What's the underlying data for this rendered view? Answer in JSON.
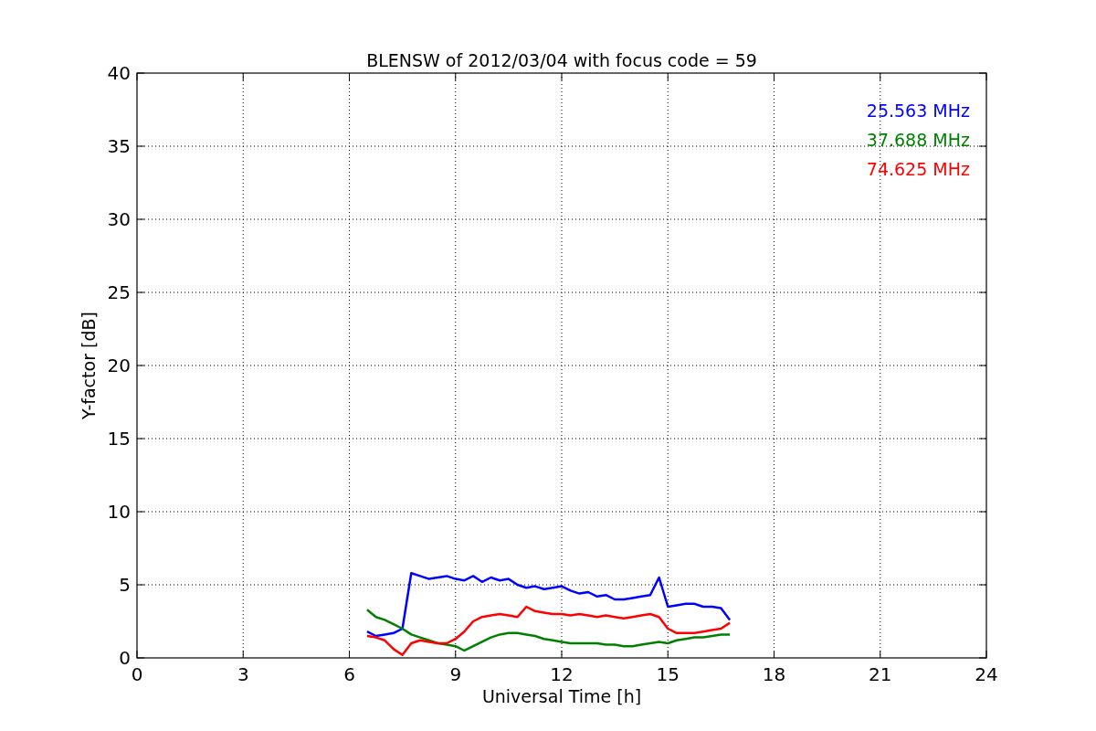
{
  "chart_data": {
    "type": "line",
    "title": "BLENSW of 2012/03/04 with focus code = 59",
    "xlabel": "Universal Time [h]",
    "ylabel": "Y-factor [dB]",
    "grid": true,
    "xlim": [
      0,
      24
    ],
    "ylim": [
      0,
      40
    ],
    "xticks": [
      0,
      3,
      6,
      9,
      12,
      15,
      18,
      21,
      24
    ],
    "yticks": [
      0,
      5,
      10,
      15,
      20,
      25,
      30,
      35,
      40
    ],
    "x": [
      6.5,
      6.75,
      7.0,
      7.25,
      7.5,
      7.75,
      8.0,
      8.25,
      8.5,
      8.75,
      9.0,
      9.25,
      9.5,
      9.75,
      10.0,
      10.25,
      10.5,
      10.75,
      11.0,
      11.25,
      11.5,
      11.75,
      12.0,
      12.25,
      12.5,
      12.75,
      13.0,
      13.25,
      13.5,
      13.75,
      14.0,
      14.25,
      14.5,
      14.75,
      15.0,
      15.25,
      15.5,
      15.75,
      16.0,
      16.25,
      16.5,
      16.75
    ],
    "series": [
      {
        "name": "25.563 MHz",
        "color": "#0000ff",
        "values": [
          1.8,
          1.5,
          1.6,
          1.7,
          2.0,
          5.8,
          5.6,
          5.4,
          5.5,
          5.6,
          5.4,
          5.3,
          5.6,
          5.2,
          5.5,
          5.3,
          5.4,
          5.0,
          4.8,
          4.9,
          4.7,
          4.8,
          4.9,
          4.6,
          4.4,
          4.5,
          4.2,
          4.3,
          4.0,
          4.0,
          4.1,
          4.2,
          4.3,
          5.5,
          3.5,
          3.6,
          3.7,
          3.7,
          3.5,
          3.5,
          3.4,
          2.6
        ]
      },
      {
        "name": "37.688 MHz",
        "color": "#008000",
        "values": [
          3.3,
          2.8,
          2.6,
          2.3,
          2.0,
          1.6,
          1.4,
          1.2,
          1.0,
          0.9,
          0.8,
          0.5,
          0.8,
          1.1,
          1.4,
          1.6,
          1.7,
          1.7,
          1.6,
          1.5,
          1.3,
          1.2,
          1.1,
          1.0,
          1.0,
          1.0,
          1.0,
          0.9,
          0.9,
          0.8,
          0.8,
          0.9,
          1.0,
          1.1,
          1.0,
          1.2,
          1.3,
          1.4,
          1.4,
          1.5,
          1.6,
          1.6
        ]
      },
      {
        "name": "74.625 MHz",
        "color": "#ff0000",
        "values": [
          1.5,
          1.4,
          1.2,
          0.6,
          0.2,
          1.0,
          1.2,
          1.1,
          1.0,
          1.0,
          1.3,
          1.8,
          2.5,
          2.8,
          2.9,
          3.0,
          2.9,
          2.8,
          3.5,
          3.2,
          3.1,
          3.0,
          3.0,
          2.9,
          3.0,
          2.9,
          2.8,
          2.9,
          2.8,
          2.7,
          2.8,
          2.9,
          3.0,
          2.8,
          2.0,
          1.7,
          1.7,
          1.7,
          1.8,
          1.9,
          2.0,
          2.4
        ]
      }
    ]
  }
}
